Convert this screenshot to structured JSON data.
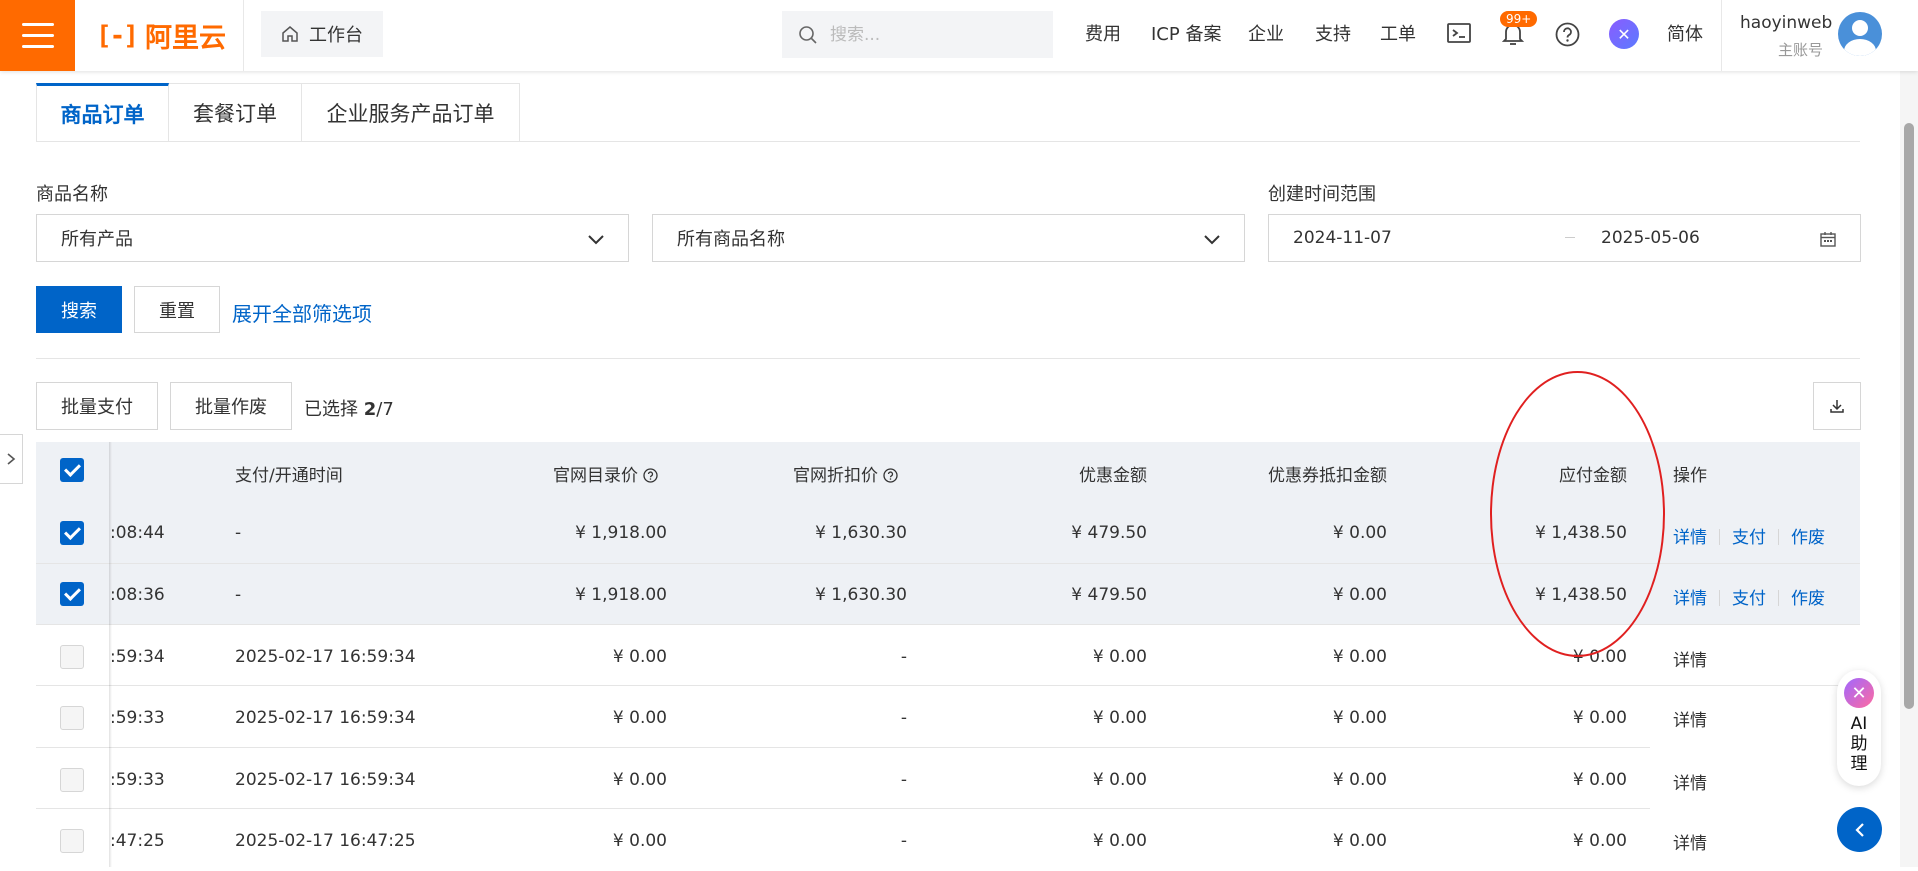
{
  "topbar": {
    "logo_text": "阿里云",
    "workbench_label": "工作台",
    "search_placeholder": "搜索...",
    "nav": [
      "费用",
      "ICP 备案",
      "企业",
      "支持",
      "工单"
    ],
    "notification_badge": "99+",
    "lang_label": "简体",
    "user_name": "haoyinweb",
    "user_account_type": "主账号",
    "brand_color": "#ff6a00"
  },
  "tabs": [
    {
      "label": "商品订单",
      "active": true
    },
    {
      "label": "套餐订单",
      "active": false
    },
    {
      "label": "企业服务产品订单",
      "active": false
    }
  ],
  "filters": {
    "product_name_label": "商品名称",
    "product_select": "所有产品",
    "product_name_select": "所有商品名称",
    "date_range_label": "创建时间范围",
    "date_start": "2024-11-07",
    "date_end": "2025-05-06",
    "search_label": "搜索",
    "reset_label": "重置",
    "expand_label": "展开全部筛选项"
  },
  "toolbar": {
    "batch_pay_label": "批量支付",
    "batch_void_label": "批量作废",
    "selected_prefix": "已选择",
    "selected_count": "2",
    "selected_total": "/7"
  },
  "table": {
    "headers": {
      "pay_time": "支付/开通时间",
      "list_price": "官网目录价",
      "discount_price": "官网折扣价",
      "promo_amount": "优惠金额",
      "coupon_amount": "优惠券抵扣金额",
      "payable": "应付金额",
      "actions": "操作"
    },
    "rows": [
      {
        "time": ":08:44",
        "pay_time": "-",
        "list_price": "¥ 1,918.00",
        "discount_price": "¥ 1,630.30",
        "promo": "¥ 479.50",
        "coupon": "¥ 0.00",
        "payable": "¥ 1,438.50",
        "selected": true,
        "actions": [
          "详情",
          "支付",
          "作废"
        ]
      },
      {
        "time": ":08:36",
        "pay_time": "-",
        "list_price": "¥ 1,918.00",
        "discount_price": "¥ 1,630.30",
        "promo": "¥ 479.50",
        "coupon": "¥ 0.00",
        "payable": "¥ 1,438.50",
        "selected": true,
        "actions": [
          "详情",
          "支付",
          "作废"
        ]
      },
      {
        "time": ":59:34",
        "pay_time": "2025-02-17 16:59:34",
        "list_price": "¥ 0.00",
        "discount_price": "-",
        "promo": "¥ 0.00",
        "coupon": "¥ 0.00",
        "payable": "¥ 0.00",
        "selected": false,
        "actions": [
          "详情"
        ]
      },
      {
        "time": ":59:33",
        "pay_time": "2025-02-17 16:59:34",
        "list_price": "¥ 0.00",
        "discount_price": "-",
        "promo": "¥ 0.00",
        "coupon": "¥ 0.00",
        "payable": "¥ 0.00",
        "selected": false,
        "actions": [
          "详情"
        ]
      },
      {
        "time": ":59:33",
        "pay_time": "2025-02-17 16:59:34",
        "list_price": "¥ 0.00",
        "discount_price": "-",
        "promo": "¥ 0.00",
        "coupon": "¥ 0.00",
        "payable": "¥ 0.00",
        "selected": false,
        "actions": [
          "详情"
        ]
      },
      {
        "time": ":47:25",
        "pay_time": "2025-02-17 16:47:25",
        "list_price": "¥ 0.00",
        "discount_price": "-",
        "promo": "¥ 0.00",
        "coupon": "¥ 0.00",
        "payable": "¥ 0.00",
        "selected": false,
        "actions": [
          "详情"
        ]
      }
    ]
  },
  "ai_assistant": {
    "label": "AI助理"
  },
  "accent_color": "#0064c8",
  "annotation_color": "#e02020"
}
